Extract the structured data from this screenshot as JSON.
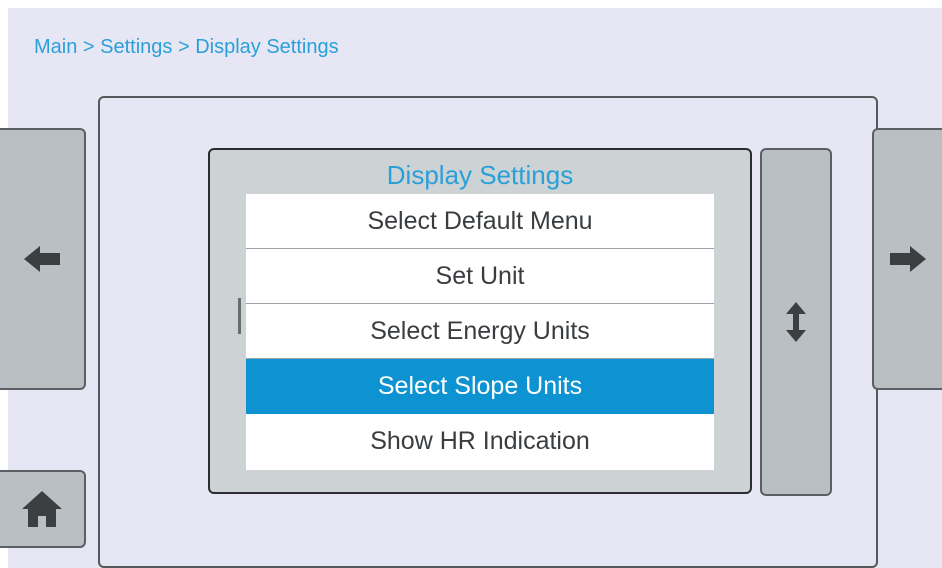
{
  "breadcrumb": "Main > Settings > Display Settings",
  "panel": {
    "title": "Display Settings",
    "items": [
      {
        "label": "Select Default Menu",
        "selected": false
      },
      {
        "label": "Set Unit",
        "selected": false
      },
      {
        "label": "Select Energy Units",
        "selected": false
      },
      {
        "label": "Select Slope Units",
        "selected": true
      },
      {
        "label": "Show HR Indication",
        "selected": false
      }
    ]
  },
  "icons": {
    "back": "arrow-left-icon",
    "forward": "arrow-right-icon",
    "home": "home-icon",
    "scroll": "up-down-arrow-icon"
  },
  "colors": {
    "accent": "#2aa0d8",
    "selection": "#0d93d2",
    "background": "#e6e6f4",
    "button": "#b9bfc2"
  }
}
